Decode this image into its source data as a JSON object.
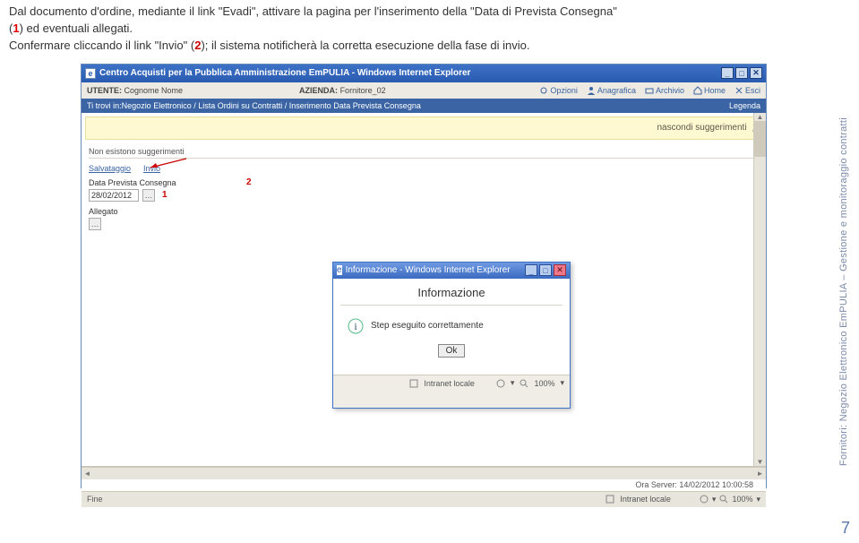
{
  "topdesc": {
    "l1a": "Dal documento d'ordine, mediante il link \"Evadi\", attivare la pagina per l'inserimento della \"Data di Prevista Consegna\"",
    "l1b": "(",
    "l1c": "1",
    "l1d": ") ed eventuali allegati.",
    "l2a": "Confermare cliccando il link \"Invio\" (",
    "l2b": "2",
    "l2c": "); il sistema notificherà la corretta esecuzione della fase di invio."
  },
  "window": {
    "title": "Centro Acquisti per la Pubblica Amministrazione EmPULIA - Windows Internet Explorer",
    "userbar": {
      "utente_lbl": "UTENTE:",
      "utente_val": "Cognome Nome",
      "azienda_lbl": "AZIENDA:",
      "azienda_val": "Fornitore_02",
      "links": {
        "opzioni": "Opzioni",
        "anagrafica": "Anagrafica",
        "archivio": "Archivio",
        "home": "Home",
        "esci": "Esci"
      }
    },
    "crumbs": {
      "path": "Ti trovi in:Negozio Elettronico / Lista Ordini su Contratti / Inserimento Data Prevista Consegna",
      "legend": "Legenda"
    },
    "hint": "nascondi suggerimenti",
    "nosuggest": "Non esistono suggerimenti",
    "actions": {
      "salvataggio": "Salvataggio",
      "invio": "Invio"
    },
    "date_lbl": "Data Prevista Consegna",
    "date_val": "28/02/2012",
    "allegato_lbl": "Allegato",
    "ann1": "1",
    "ann2": "2",
    "ora_prefix": "Ora Server: ",
    "ora_val": "14/02/2012 10:00:58",
    "status": {
      "fine": "Fine",
      "zone": "Intranet locale",
      "zoom": "100%"
    }
  },
  "dialog": {
    "title": "Informazione - Windows Internet Explorer",
    "heading": "Informazione",
    "msg": "Step eseguito correttamente",
    "ok": "Ok",
    "status": {
      "zone": "Intranet locale",
      "zoom": "100%"
    }
  },
  "side": {
    "text": "Fornitori: Negozio Elettronico EmPULIA – Gestione e monitoraggio contratti",
    "pagenum": "7"
  }
}
